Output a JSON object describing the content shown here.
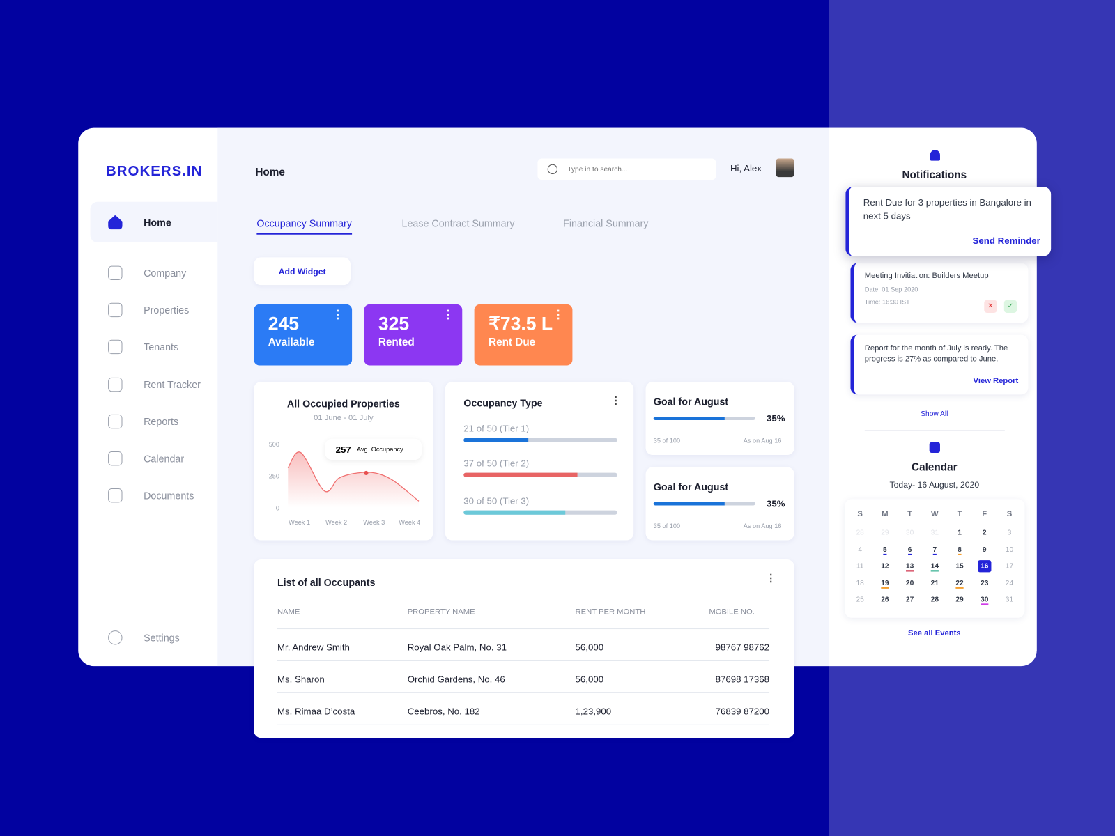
{
  "brand": "BROKERS.IN",
  "header": {
    "title": "Home",
    "search_placeholder": "Type in to search...",
    "greeting": "Hi, Alex"
  },
  "sidebar": {
    "items": [
      {
        "label": "Home",
        "icon": "home-icon",
        "active": true
      },
      {
        "label": "Company",
        "icon": "grid-icon"
      },
      {
        "label": "Properties",
        "icon": "folder-icon"
      },
      {
        "label": "Tenants",
        "icon": "user-icon"
      },
      {
        "label": "Rent Tracker",
        "icon": "tracker-icon"
      },
      {
        "label": "Reports",
        "icon": "pie-chart-icon"
      },
      {
        "label": "Calendar",
        "icon": "calendar-icon"
      },
      {
        "label": "Documents",
        "icon": "document-icon"
      }
    ],
    "settings": "Settings"
  },
  "tabs": [
    {
      "label": "Occupancy Summary",
      "active": true
    },
    {
      "label": "Lease Contract Summary"
    },
    {
      "label": "Financial Summary"
    }
  ],
  "add_widget": "Add Widget",
  "stats": [
    {
      "value": "245",
      "label": "Available",
      "color": "#2b7bf5"
    },
    {
      "value": "325",
      "label": "Rented",
      "color": "#8c37f2"
    },
    {
      "value": "₹73.5 L",
      "label": "Rent Due",
      "color": "#ff8750"
    }
  ],
  "chart_data": {
    "type": "area",
    "title": "All Occupied Properties",
    "subtitle": "01 June - 01 July",
    "categories": [
      "Week 1",
      "Week 2",
      "Week 3",
      "Week 4"
    ],
    "x": [
      0.6,
      0.95,
      1.6,
      2.0,
      2.5,
      3.0,
      3.5,
      4.2
    ],
    "y": [
      310,
      430,
      130,
      230,
      270,
      270,
      210,
      50
    ],
    "yticks": [
      0,
      250,
      500
    ],
    "ylim": [
      0,
      500
    ],
    "highlight": {
      "x": 2.75,
      "y": 257,
      "value": "257",
      "label": "Avg. Occupancy"
    },
    "color": "#f07070",
    "grid": false
  },
  "occupancy": {
    "title": "Occupancy Type",
    "rows": [
      {
        "label": "21 of 50 (Tier 1)",
        "pct": 42,
        "color": "#1a73d9"
      },
      {
        "label": "37 of 50 (Tier 2)",
        "pct": 74,
        "color": "#e86464"
      },
      {
        "label": "30 of 50 (Tier 3)",
        "pct": 66,
        "color": "#6cc9d9"
      }
    ]
  },
  "goals": [
    {
      "title": "Goal for August",
      "pct_label": "35%",
      "pct": 70,
      "left": "35 of 100",
      "right": "As on Aug 16"
    },
    {
      "title": "Goal for August",
      "pct_label": "35%",
      "pct": 70,
      "left": "35 of 100",
      "right": "As on Aug 16"
    }
  ],
  "table": {
    "title": "List of all Occupants",
    "columns": [
      "NAME",
      "PROPERTY NAME",
      "RENT PER MONTH",
      "MOBILE NO."
    ],
    "rows": [
      [
        "Mr. Andrew Smith",
        "Royal Oak Palm, No. 31",
        "56,000",
        "98767 98762"
      ],
      [
        "Ms. Sharon",
        "Orchid Gardens, No. 46",
        "56,000",
        "87698 17368"
      ],
      [
        "Ms. Rimaa D’costa",
        "Ceebros, No. 182",
        "1,23,900",
        "76839 87200"
      ]
    ]
  },
  "notifications": {
    "title": "Notifications",
    "n1": {
      "text": "Rent Due for 3 properties in Bangalore in next 5 days",
      "action": "Send Reminder"
    },
    "n2": {
      "title": "Meeting Invitiation: Builders Meetup",
      "date": "Date: 01 Sep 2020",
      "time": "Time: 16:30 IST"
    },
    "n3": {
      "text": "Report for the month of July  is ready. The progress is 27% as compared to June.",
      "action": "View Report"
    },
    "show_all": "Show All"
  },
  "calendar": {
    "title": "Calendar",
    "today": "Today- 16 August, 2020",
    "days": [
      "S",
      "M",
      "T",
      "W",
      "T",
      "F",
      "S"
    ],
    "weeks": [
      [
        "28",
        "29",
        "30",
        "31",
        "1",
        "2",
        "3"
      ],
      [
        "4",
        "5",
        "6",
        "7",
        "8",
        "9",
        "10"
      ],
      [
        "11",
        "12",
        "13",
        "14",
        "15",
        "16",
        "17"
      ],
      [
        "18",
        "19",
        "20",
        "21",
        "22",
        "23",
        "24"
      ],
      [
        "25",
        "26",
        "27",
        "28",
        "29",
        "30",
        "31"
      ]
    ],
    "marks": {
      "5": "#2424d8",
      "6": "#2424d8",
      "7": "#2424d8",
      "8": "#f5a030",
      "13": "#c8102e",
      "14": "#14a37f",
      "19": "#f5a030",
      "22": "#f5a030",
      "30": "#d03ee8"
    },
    "see_all": "See all Events"
  }
}
